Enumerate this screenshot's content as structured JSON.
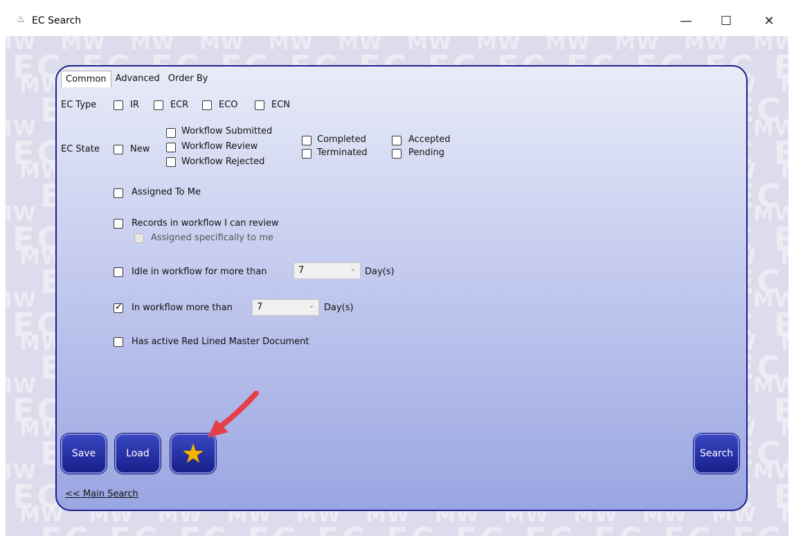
{
  "window": {
    "title": "EC Search",
    "icon": "mw-app-icon",
    "minimize_glyph": "—",
    "maximize_glyph": "☐",
    "close_glyph": "✕"
  },
  "watermark": {
    "mw_text": "MW",
    "ec_text": "EC"
  },
  "tabs": [
    {
      "label": "Common",
      "active": true
    },
    {
      "label": "Advanced",
      "active": false
    },
    {
      "label": "Order By",
      "active": false
    }
  ],
  "ec_type": {
    "label": "EC Type",
    "options": [
      {
        "label": "IR",
        "checked": false
      },
      {
        "label": "ECR",
        "checked": false
      },
      {
        "label": "ECO",
        "checked": false
      },
      {
        "label": "ECN",
        "checked": false
      }
    ]
  },
  "ec_state": {
    "label": "EC State",
    "new": {
      "label": "New",
      "checked": false
    },
    "workflow_submitted": {
      "label": "Workflow Submitted",
      "checked": false
    },
    "workflow_review": {
      "label": "Workflow Review",
      "checked": false
    },
    "workflow_rejected": {
      "label": "Workflow Rejected",
      "checked": false
    },
    "completed": {
      "label": "Completed",
      "checked": false
    },
    "terminated": {
      "label": "Terminated",
      "checked": false
    },
    "accepted": {
      "label": "Accepted",
      "checked": false
    },
    "pending": {
      "label": "Pending",
      "checked": false
    }
  },
  "assigned_to_me": {
    "label": "Assigned To Me",
    "checked": false
  },
  "records_review": {
    "label": "Records in workflow I can review",
    "checked": false
  },
  "assigned_specifically": {
    "label": "Assigned specifically to me",
    "checked": false,
    "disabled": true
  },
  "idle": {
    "label": "Idle in workflow for more than",
    "checked": false,
    "value": "7",
    "unit": "Day(s)"
  },
  "in_workflow": {
    "label": "In workflow more than",
    "checked": true,
    "value": "7",
    "unit": "Day(s)"
  },
  "red_lined": {
    "label": "Has active Red Lined Master Document",
    "checked": false
  },
  "buttons": {
    "save": "Save",
    "load": "Load",
    "favorite_icon": "star-icon",
    "search": "Search"
  },
  "main_search_link": "<< Main Search",
  "colors": {
    "panel_border": "#1c1c8a",
    "button_bg": "#2a35a8",
    "star": "#f7b500",
    "arrow": "#e5404a"
  }
}
